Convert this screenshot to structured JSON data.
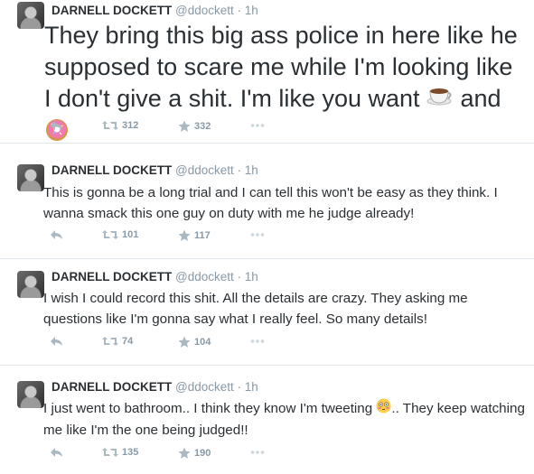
{
  "tweets": [
    {
      "name": "DARNELL DOCKETT",
      "handle": "@ddockett",
      "dot": "·",
      "time": "1h",
      "text_before": "They bring this big ass police in here like he supposed to scare me while I'm looking like I don't give a shit. I'm like you want ",
      "text_mid": " and ",
      "text_after": "",
      "retweets": "312",
      "favorites": "332",
      "emoji1": "coffee-cup-icon",
      "emoji2": "donut-icon"
    },
    {
      "name": "DARNELL DOCKETT",
      "handle": "@ddockett",
      "dot": "·",
      "time": "1h",
      "text": "This is gonna be a long trial and I can tell this won't be easy as they think. I wanna smack this one guy on duty with me he judge already!",
      "retweets": "101",
      "favorites": "117"
    },
    {
      "name": "DARNELL DOCKETT",
      "handle": "@ddockett",
      "dot": "·",
      "time": "1h",
      "text": "I wish I could record this shit. All the details are crazy. They asking me questions like I'm gonna say what I really feel. So many details!",
      "retweets": "74",
      "favorites": "104"
    },
    {
      "name": "DARNELL DOCKETT",
      "handle": "@ddockett",
      "dot": "·",
      "time": "1h",
      "text_before": "I just went to bathroom.. I think they know I'm tweeting ",
      "text_after": "..  They keep watching me like I'm the one being judged!!",
      "retweets": "135",
      "favorites": "190",
      "emoji1": "flushed-face-icon"
    }
  ],
  "colors": {
    "text": "#292f33",
    "muted": "#8899a6",
    "divider": "#e1e8ed"
  }
}
